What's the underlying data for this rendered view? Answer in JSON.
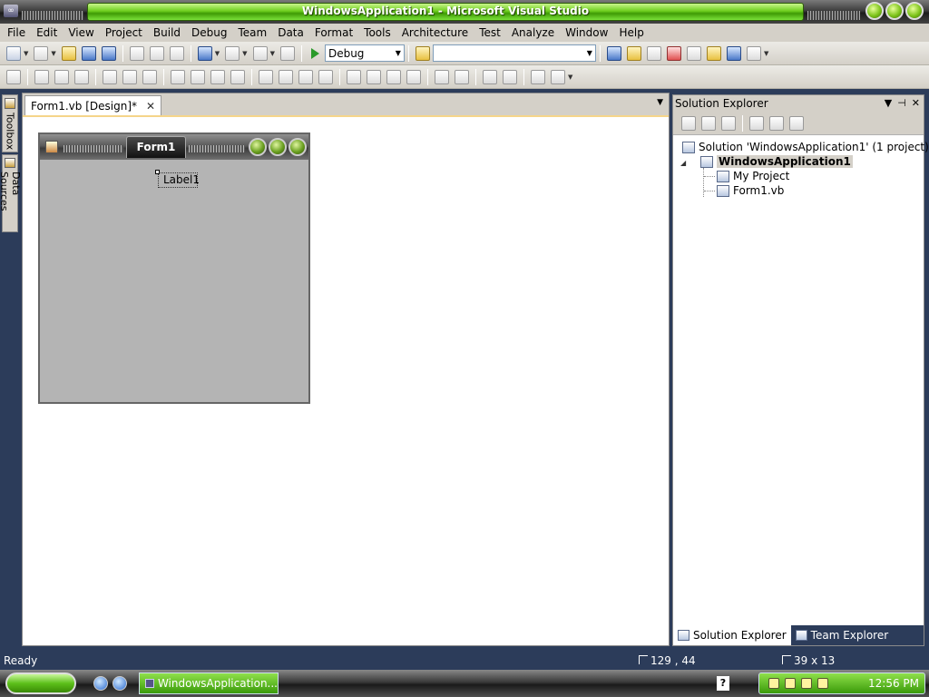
{
  "window": {
    "title": "WindowsApplication1 - Microsoft Visual Studio"
  },
  "menu": [
    "File",
    "Edit",
    "View",
    "Project",
    "Build",
    "Debug",
    "Team",
    "Data",
    "Format",
    "Tools",
    "Architecture",
    "Test",
    "Analyze",
    "Window",
    "Help"
  ],
  "toolbar": {
    "config_value": "Debug",
    "platform_value": ""
  },
  "left_strip": {
    "toolbox": "Toolbox",
    "data_sources": "Data Sources"
  },
  "document": {
    "tab_label": "Form1.vb [Design]*",
    "form": {
      "caption": "Form1",
      "label_text": "Label1"
    }
  },
  "solution_explorer": {
    "title": "Solution Explorer",
    "solution": "Solution 'WindowsApplication1' (1 project)",
    "project": "WindowsApplication1",
    "items": [
      "My Project",
      "Form1.vb"
    ],
    "tabs": [
      "Solution Explorer",
      "Team Explorer"
    ]
  },
  "status": {
    "ready": "Ready",
    "position": "129 , 44",
    "size": "39 x 13"
  },
  "taskbar": {
    "task": "WindowsApplication...",
    "help": "?",
    "clock": "12:56 PM"
  },
  "colors": {
    "title_green": "#6fcf1f",
    "chrome": "#2c3c5a",
    "toolbar": "#d4d0c8"
  }
}
